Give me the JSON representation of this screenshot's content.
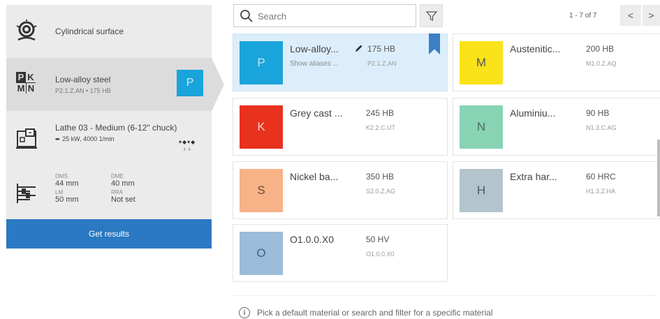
{
  "sidebar": {
    "surface": {
      "title": "Cylindrical surface",
      "icon": "cylinder-surface-icon"
    },
    "material": {
      "title": "Low-alloy steel",
      "subtitle": "P2.1.Z.AN • 175 HB",
      "icon_letters": [
        "P",
        "K",
        "M",
        "N"
      ],
      "badge": "P",
      "badge_color": "#1aa4dc"
    },
    "machine": {
      "title": "Lathe 03 - Medium (6-12\" chuck)",
      "subtitle": "25 kW, 4000 1/min",
      "icon": "lathe-icon",
      "extra": "▾◆▾◆\n♁♁"
    },
    "dimensions": {
      "icon": "dimensions-icon",
      "fields": [
        {
          "label": "DMS",
          "value": "44 mm"
        },
        {
          "label": "DME",
          "value": "40 mm"
        },
        {
          "label": "LM",
          "value": "50 mm"
        },
        {
          "label": "RRA",
          "value": "Not set"
        }
      ]
    },
    "get_results": "Get results"
  },
  "search": {
    "placeholder": "Search",
    "value": ""
  },
  "pager": {
    "text": "1 - 7 of 7",
    "prev": "<",
    "next": ">"
  },
  "materials": [
    {
      "letter": "P",
      "name": "Low-alloy...",
      "alias": "Show aliases ...",
      "hardness": "175 HB",
      "code": "P2.1.Z.AN",
      "color": "#1aa4dc",
      "text_color": "#c7e7f6",
      "selected": true
    },
    {
      "letter": "M",
      "name": "Austenitic...",
      "alias": "",
      "hardness": "200 HB",
      "code": "M1.0.Z.AQ",
      "color": "#fbe319",
      "text_color": "#555",
      "selected": false
    },
    {
      "letter": "K",
      "name": "Grey cast ...",
      "alias": "",
      "hardness": "245 HB",
      "code": "K2.2.C.UT",
      "color": "#e8321e",
      "text_color": "#f6cfc9",
      "selected": false
    },
    {
      "letter": "N",
      "name": "Aluminiu...",
      "alias": "",
      "hardness": "90 HB",
      "code": "N1.3.C.AG",
      "color": "#88d3b4",
      "text_color": "#4a6a5f",
      "selected": false
    },
    {
      "letter": "S",
      "name": "Nickel ba...",
      "alias": "",
      "hardness": "350 HB",
      "code": "S2.0.Z.AG",
      "color": "#f7b287",
      "text_color": "#6a4a35",
      "selected": false
    },
    {
      "letter": "H",
      "name": "Extra har...",
      "alias": "",
      "hardness": "60 HRC",
      "code": "H1.3.Z.HA",
      "color": "#b3c4cc",
      "text_color": "#4a5a62",
      "selected": false
    },
    {
      "letter": "O",
      "name": "O1.0.0.X0",
      "alias": "",
      "hardness": "50 HV",
      "code": "O1.0.0.X0",
      "color": "#9cbcd9",
      "text_color": "#44617d",
      "selected": false
    }
  ],
  "hint": "Pick a default material or search and filter for a specific material"
}
